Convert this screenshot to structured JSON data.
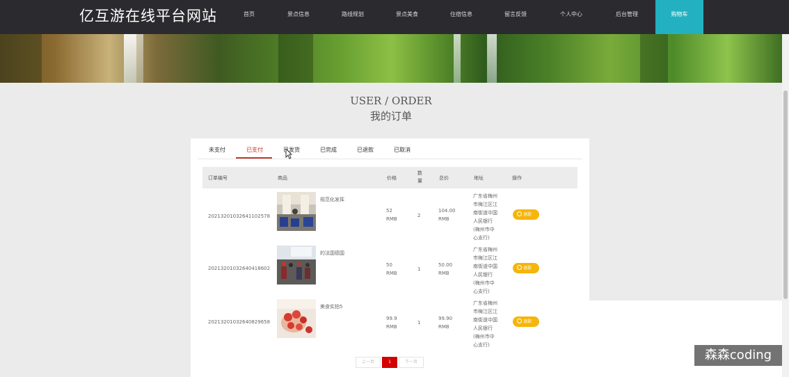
{
  "brand": "亿互游在线平台网站",
  "nav": [
    "首页",
    "景点信息",
    "路线规划",
    "景点美食",
    "住宿信息",
    "留言反馈",
    "个人中心",
    "后台管理",
    "购物车"
  ],
  "page": {
    "title_en": "USER / ORDER",
    "title_cn": "我的订单"
  },
  "tabs": [
    "未支付",
    "已支付",
    "已发货",
    "已完成",
    "已退款",
    "已取消"
  ],
  "active_tab": "已支付",
  "columns": [
    "订单编号",
    "商品",
    "价格",
    "数量",
    "总价",
    "地址",
    "操作"
  ],
  "orders": [
    {
      "order_no": "20213201032641102578",
      "product": "规范化发挥",
      "price": [
        "52",
        "RMB"
      ],
      "qty": "2",
      "total": [
        "104.00",
        "RMB"
      ],
      "address": [
        "广东省梅州",
        "市梅江区江",
        "南街道中国",
        "人民银行",
        "(梅州市中",
        "心支行)"
      ],
      "action": "退款",
      "image": "meeting-room"
    },
    {
      "order_no": "20213201032640418602",
      "product": "的法国德国",
      "price": [
        "50",
        "RMB"
      ],
      "qty": "1",
      "total": [
        "50.00",
        "RMB"
      ],
      "address": [
        "广东省梅州",
        "市梅江区江",
        "南街道中国",
        "人民银行",
        "(梅州市中",
        "心支行)"
      ],
      "action": "退款",
      "image": "classroom"
    },
    {
      "order_no": "20213201032640829658",
      "product": "美食实拍5",
      "price": [
        "99.9",
        "RMB"
      ],
      "qty": "1",
      "total": [
        "99.90",
        "RMB"
      ],
      "address": [
        "广东省梅州",
        "市梅江区江",
        "南街道中国",
        "人民银行",
        "(梅州市中",
        "心支行)"
      ],
      "action": "退款",
      "image": "strawberry-cake"
    }
  ],
  "pagination": {
    "prev": "上一页",
    "current": "1",
    "next": "下一页"
  },
  "watermark": "森森coding",
  "colors": {
    "navbar": "#2b2b2f",
    "nav_active": "#23b0c0",
    "accent": "#c0392b",
    "button": "#f5b50a",
    "page_current": "#d40000"
  }
}
